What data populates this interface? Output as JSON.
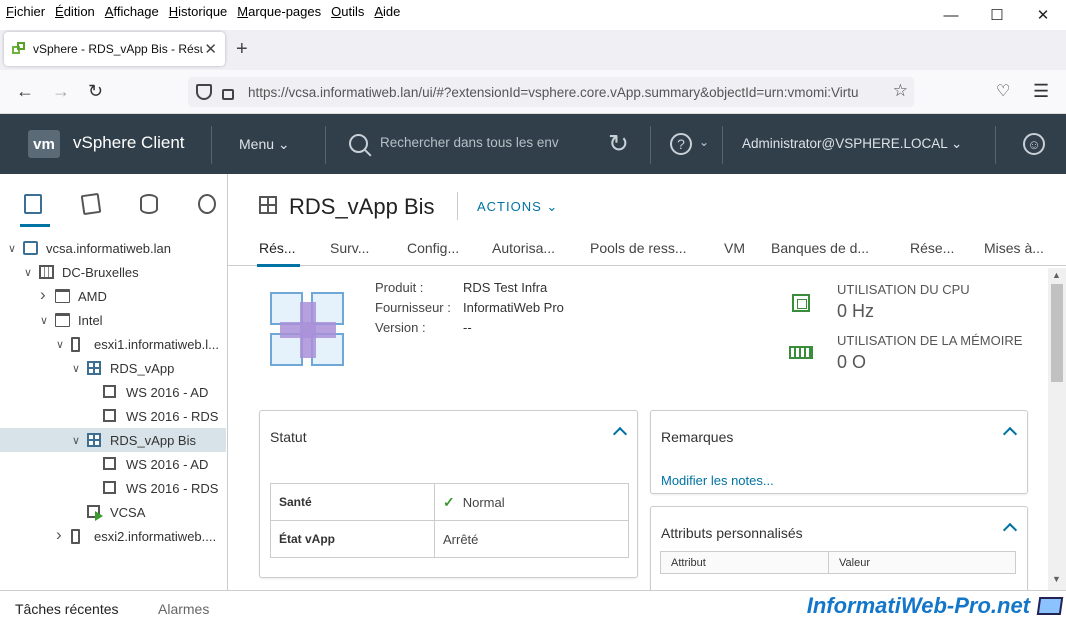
{
  "browser": {
    "menu": [
      "Fichier",
      "Édition",
      "Affichage",
      "Historique",
      "Marque-pages",
      "Outils",
      "Aide"
    ],
    "tab_title": "vSphere - RDS_vApp Bis - Résumé",
    "url": "https://vcsa.informatiweb.lan/ui/#?extensionId=vsphere.core.vApp.summary&objectId=urn:vmomi:Virtu"
  },
  "header": {
    "logo": "vm",
    "app_title": "vSphere Client",
    "menu_label": "Menu",
    "search_placeholder": "Rechercher dans tous les env",
    "user": "Administrator@VSPHERE.LOCAL"
  },
  "tree": [
    {
      "label": "vcsa.informatiweb.lan",
      "icon": "vcenter-icon",
      "level": 0,
      "caret": "v"
    },
    {
      "label": "DC-Bruxelles",
      "icon": "datacenter-icon",
      "level": 1,
      "caret": "v"
    },
    {
      "label": "AMD",
      "icon": "folder-icon",
      "level": 2,
      "caret": ">"
    },
    {
      "label": "Intel",
      "icon": "folder-icon",
      "level": 2,
      "caret": "v"
    },
    {
      "label": "esxi1.informatiweb.l...",
      "icon": "host-icon",
      "level": 3,
      "caret": "v"
    },
    {
      "label": "RDS_vApp",
      "icon": "vapp-icon",
      "level": 4,
      "caret": "v"
    },
    {
      "label": "WS 2016 - AD",
      "icon": "vm-icon",
      "level": 5,
      "caret": ""
    },
    {
      "label": "WS 2016 - RDS",
      "icon": "vm-icon",
      "level": 5,
      "caret": ""
    },
    {
      "label": "RDS_vApp Bis",
      "icon": "vapp-icon",
      "level": 4,
      "caret": "v"
    },
    {
      "label": "WS 2016 - AD",
      "icon": "vm-icon",
      "level": 5,
      "caret": ""
    },
    {
      "label": "WS 2016 - RDS",
      "icon": "vm-icon",
      "level": 5,
      "caret": ""
    },
    {
      "label": "VCSA",
      "icon": "vm-powered-on-icon",
      "level": 4,
      "caret": ""
    },
    {
      "label": "esxi2.informatiweb....",
      "icon": "host-icon",
      "level": 3,
      "caret": ">"
    }
  ],
  "object": {
    "title": "RDS_vApp Bis",
    "actions_label": "ACTIONS"
  },
  "tabs": [
    "Rés...",
    "Surv...",
    "Config...",
    "Autorisa...",
    "Pools de ress...",
    "VM",
    "Banques de d...",
    "Rése...",
    "Mises à..."
  ],
  "summary": {
    "product_key": "Produit :",
    "product_value": "RDS Test Infra",
    "vendor_key": "Fournisseur :",
    "vendor_value": "InformatiWeb Pro",
    "version_key": "Version :",
    "version_value": "--",
    "cpu_label": "UTILISATION DU CPU",
    "cpu_value": "0 Hz",
    "mem_label": "UTILISATION DE LA MÉMOIRE",
    "mem_value": "0 O"
  },
  "status_card": {
    "title": "Statut",
    "health_key": "Santé",
    "health_value": "Normal",
    "state_key": "État vApp",
    "state_value": "Arrêté"
  },
  "notes_card": {
    "title": "Remarques",
    "link": "Modifier les notes..."
  },
  "attributes_card": {
    "title": "Attributs personnalisés",
    "col_attr": "Attribut",
    "col_value": "Valeur"
  },
  "bottom": {
    "recent_tasks": "Tâches récentes",
    "alarms": "Alarmes",
    "watermark": "InformatiWeb-Pro.net"
  },
  "colors": {
    "header_bg": "#313f4a",
    "accent": "#0072a3",
    "ok_green": "#3a9a2e"
  }
}
